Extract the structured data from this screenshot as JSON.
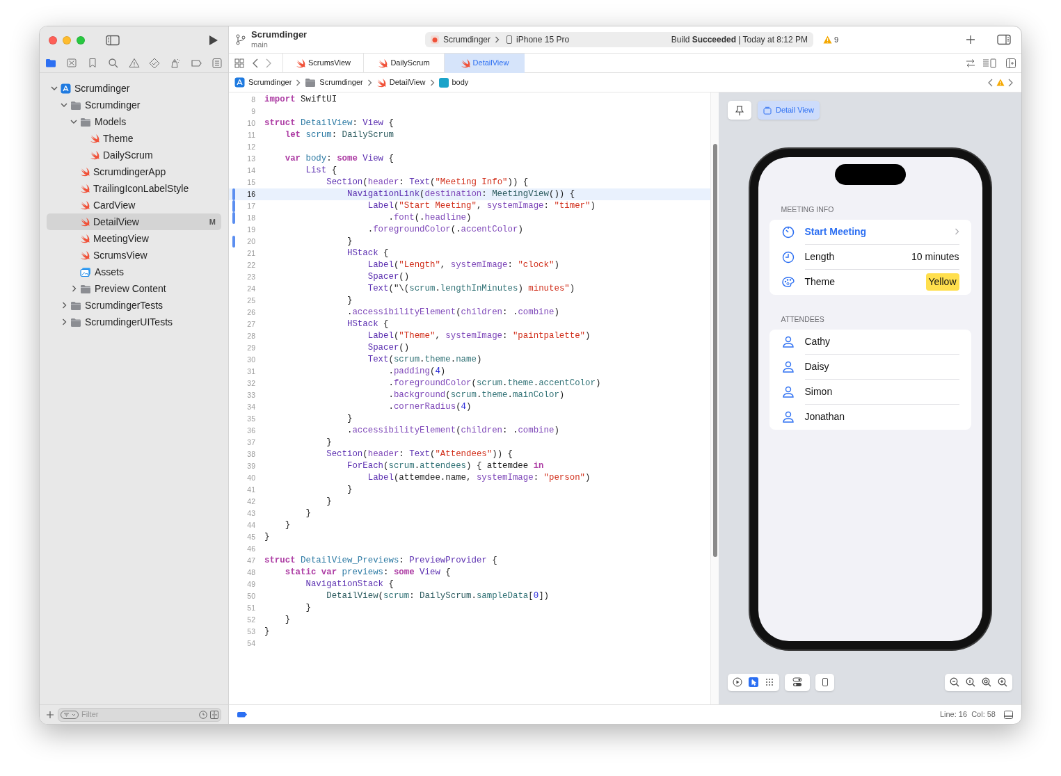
{
  "toolbar": {
    "project": "Scrumdinger",
    "branch": "main",
    "scheme": "Scrumdinger",
    "device": "iPhone 15 Pro",
    "build_status": "Build **Succeeded** | Today at 8:12 PM",
    "warning_count": "9"
  },
  "navigator_tabs": [
    {
      "kind": "project",
      "selected": true
    },
    {
      "kind": "source_control",
      "selected": false
    },
    {
      "kind": "bookmarks",
      "selected": false
    },
    {
      "kind": "find",
      "selected": false
    },
    {
      "kind": "issues",
      "selected": false
    },
    {
      "kind": "tests",
      "selected": false
    },
    {
      "kind": "debug",
      "selected": false
    },
    {
      "kind": "breakpoints",
      "selected": false
    },
    {
      "kind": "reports",
      "selected": false
    }
  ],
  "navigator": {
    "tree": [
      {
        "label": "Scrumdinger",
        "kind": "project",
        "expanded": true,
        "selected": false,
        "children": [
          {
            "label": "Scrumdinger",
            "kind": "folder",
            "expanded": true,
            "selected": false,
            "children": [
              {
                "label": "Models",
                "kind": "folder",
                "expanded": true,
                "selected": false,
                "children": [
                  {
                    "label": "Theme",
                    "kind": "swift",
                    "selected": false
                  },
                  {
                    "label": "DailyScrum",
                    "kind": "swift",
                    "selected": false
                  }
                ]
              },
              {
                "label": "ScrumdingerApp",
                "kind": "swift",
                "selected": false
              },
              {
                "label": "TrailingIconLabelStyle",
                "kind": "swift",
                "selected": false
              },
              {
                "label": "CardView",
                "kind": "swift",
                "selected": false
              },
              {
                "label": "DetailView",
                "kind": "swift",
                "selected": true,
                "badge": "M"
              },
              {
                "label": "MeetingView",
                "kind": "swift",
                "selected": false
              },
              {
                "label": "ScrumsView",
                "kind": "swift",
                "selected": false
              },
              {
                "label": "Assets",
                "kind": "assets",
                "selected": false
              },
              {
                "label": "Preview Content",
                "kind": "folder",
                "expanded": false,
                "selected": false
              }
            ]
          },
          {
            "label": "ScrumdingerTests",
            "kind": "folder",
            "expanded": false,
            "selected": false
          },
          {
            "label": "ScrumdingerUITests",
            "kind": "folder",
            "expanded": false,
            "selected": false
          }
        ]
      }
    ],
    "filter_placeholder": "Filter"
  },
  "editor": {
    "tabs": [
      {
        "label": "ScrumsView",
        "selected": false
      },
      {
        "label": "DailyScrum",
        "selected": false
      },
      {
        "label": "DetailView",
        "selected": true
      }
    ],
    "breadcrumbs": [
      {
        "label": "Scrumdinger",
        "kind": "project"
      },
      {
        "label": "Scrumdinger",
        "kind": "folder"
      },
      {
        "label": "DetailView",
        "kind": "swift"
      },
      {
        "label": "body",
        "kind": "property"
      }
    ],
    "lines": [
      {
        "number": "8",
        "current": false,
        "changed": false,
        "tokens": [
          {
            "kind": "kw",
            "text": "import"
          },
          {
            "kind": "plain",
            "text": " SwiftUI"
          }
        ]
      },
      {
        "number": "9",
        "current": false,
        "changed": false
      },
      {
        "number": "10",
        "current": false,
        "changed": false,
        "tokens": [
          {
            "kind": "kw",
            "text": "struct "
          },
          {
            "kind": "decl",
            "text": "DetailView"
          },
          {
            "kind": "plain",
            "text": ": "
          },
          {
            "kind": "sys",
            "text": "View"
          },
          {
            "kind": "plain",
            "text": " {"
          }
        ]
      },
      {
        "number": "11",
        "current": false,
        "changed": false,
        "tokens": [
          {
            "kind": "kw",
            "text": "    let "
          },
          {
            "kind": "decl",
            "text": "scrum"
          },
          {
            "kind": "plain",
            "text": ": "
          },
          {
            "kind": "proj",
            "text": "DailyScrum"
          }
        ]
      },
      {
        "number": "12",
        "current": false,
        "changed": false
      },
      {
        "number": "13",
        "current": false,
        "changed": false,
        "tokens": [
          {
            "kind": "kw",
            "text": "    var "
          },
          {
            "kind": "decl",
            "text": "body"
          },
          {
            "kind": "plain",
            "text": ": "
          },
          {
            "kind": "kw",
            "text": "some "
          },
          {
            "kind": "sys",
            "text": "View"
          },
          {
            "kind": "plain",
            "text": " {"
          }
        ]
      },
      {
        "number": "14",
        "current": false,
        "changed": false,
        "tokens": [
          {
            "kind": "sys",
            "text": "        List"
          },
          {
            "kind": "plain",
            "text": " {"
          }
        ]
      },
      {
        "number": "15",
        "current": false,
        "changed": false,
        "tokens": [
          {
            "kind": "sys",
            "text": "            Section"
          },
          {
            "kind": "plain",
            "text": "("
          },
          {
            "kind": "member",
            "text": "header"
          },
          {
            "kind": "plain",
            "text": ": "
          },
          {
            "kind": "sys",
            "text": "Text"
          },
          {
            "kind": "plain",
            "text": "("
          },
          {
            "kind": "str",
            "text": "\"Meeting Info\""
          },
          {
            "kind": "plain",
            "text": ")) {"
          }
        ]
      },
      {
        "number": "16",
        "current": true,
        "changed": true,
        "tokens": [
          {
            "kind": "sys",
            "text": "                NavigationLink"
          },
          {
            "kind": "plain",
            "text": "("
          },
          {
            "kind": "member",
            "text": "destination"
          },
          {
            "kind": "plain",
            "text": ": "
          },
          {
            "kind": "proj",
            "text": "MeetingView"
          },
          {
            "kind": "plain",
            "text": "()) {"
          }
        ]
      },
      {
        "number": "17",
        "current": false,
        "changed": true,
        "tokens": [
          {
            "kind": "sys",
            "text": "                    Label"
          },
          {
            "kind": "plain",
            "text": "("
          },
          {
            "kind": "str",
            "text": "\"Start Meeting\""
          },
          {
            "kind": "plain",
            "text": ", "
          },
          {
            "kind": "member",
            "text": "systemImage"
          },
          {
            "kind": "plain",
            "text": ": "
          },
          {
            "kind": "str",
            "text": "\"timer\""
          },
          {
            "kind": "plain",
            "text": ")"
          }
        ]
      },
      {
        "number": "18",
        "current": false,
        "changed": true,
        "tokens": [
          {
            "kind": "plain",
            "text": "                        ."
          },
          {
            "kind": "member",
            "text": "font"
          },
          {
            "kind": "plain",
            "text": "(."
          },
          {
            "kind": "member",
            "text": "headline"
          },
          {
            "kind": "plain",
            "text": ")"
          }
        ]
      },
      {
        "number": "19",
        "current": false,
        "changed": false,
        "tokens": [
          {
            "kind": "plain",
            "text": "                    ."
          },
          {
            "kind": "member",
            "text": "foregroundColor"
          },
          {
            "kind": "plain",
            "text": "(."
          },
          {
            "kind": "member",
            "text": "accentColor"
          },
          {
            "kind": "plain",
            "text": ")"
          }
        ]
      },
      {
        "number": "20",
        "current": false,
        "changed": true,
        "tokens": [
          {
            "kind": "plain",
            "text": "                }"
          }
        ]
      },
      {
        "number": "21",
        "current": false,
        "changed": false,
        "tokens": [
          {
            "kind": "sys",
            "text": "                HStack"
          },
          {
            "kind": "plain",
            "text": " {"
          }
        ]
      },
      {
        "number": "22",
        "current": false,
        "changed": false,
        "tokens": [
          {
            "kind": "sys",
            "text": "                    Label"
          },
          {
            "kind": "plain",
            "text": "("
          },
          {
            "kind": "str",
            "text": "\"Length\""
          },
          {
            "kind": "plain",
            "text": ", "
          },
          {
            "kind": "member",
            "text": "systemImage"
          },
          {
            "kind": "plain",
            "text": ": "
          },
          {
            "kind": "str",
            "text": "\"clock\""
          },
          {
            "kind": "plain",
            "text": ")"
          }
        ]
      },
      {
        "number": "23",
        "current": false,
        "changed": false,
        "tokens": [
          {
            "kind": "sys",
            "text": "                    Spacer"
          },
          {
            "kind": "plain",
            "text": "()"
          }
        ]
      },
      {
        "number": "24",
        "current": false,
        "changed": false,
        "tokens": [
          {
            "kind": "sys",
            "text": "                    Text"
          },
          {
            "kind": "plain",
            "text": "(\"\\("
          },
          {
            "kind": "prop",
            "text": "scrum"
          },
          {
            "kind": "plain",
            "text": "."
          },
          {
            "kind": "prop",
            "text": "lengthInMinutes"
          },
          {
            "kind": "plain",
            "text": ")"
          },
          {
            "kind": "str",
            "text": " minutes\""
          },
          {
            "kind": "plain",
            "text": ")"
          }
        ]
      },
      {
        "number": "25",
        "current": false,
        "changed": false,
        "tokens": [
          {
            "kind": "plain",
            "text": "                }"
          }
        ]
      },
      {
        "number": "26",
        "current": false,
        "changed": false,
        "tokens": [
          {
            "kind": "plain",
            "text": "                ."
          },
          {
            "kind": "member",
            "text": "accessibilityElement"
          },
          {
            "kind": "plain",
            "text": "("
          },
          {
            "kind": "member",
            "text": "children"
          },
          {
            "kind": "plain",
            "text": ": ."
          },
          {
            "kind": "member",
            "text": "combine"
          },
          {
            "kind": "plain",
            "text": ")"
          }
        ]
      },
      {
        "number": "27",
        "current": false,
        "changed": false,
        "tokens": [
          {
            "kind": "sys",
            "text": "                HStack"
          },
          {
            "kind": "plain",
            "text": " {"
          }
        ]
      },
      {
        "number": "28",
        "current": false,
        "changed": false,
        "tokens": [
          {
            "kind": "sys",
            "text": "                    Label"
          },
          {
            "kind": "plain",
            "text": "("
          },
          {
            "kind": "str",
            "text": "\"Theme\""
          },
          {
            "kind": "plain",
            "text": ", "
          },
          {
            "kind": "member",
            "text": "systemImage"
          },
          {
            "kind": "plain",
            "text": ": "
          },
          {
            "kind": "str",
            "text": "\"paintpalette\""
          },
          {
            "kind": "plain",
            "text": ")"
          }
        ]
      },
      {
        "number": "29",
        "current": false,
        "changed": false,
        "tokens": [
          {
            "kind": "sys",
            "text": "                    Spacer"
          },
          {
            "kind": "plain",
            "text": "()"
          }
        ]
      },
      {
        "number": "30",
        "current": false,
        "changed": false,
        "tokens": [
          {
            "kind": "sys",
            "text": "                    Text"
          },
          {
            "kind": "plain",
            "text": "("
          },
          {
            "kind": "prop",
            "text": "scrum"
          },
          {
            "kind": "plain",
            "text": "."
          },
          {
            "kind": "prop",
            "text": "theme"
          },
          {
            "kind": "plain",
            "text": "."
          },
          {
            "kind": "prop",
            "text": "name"
          },
          {
            "kind": "plain",
            "text": ")"
          }
        ]
      },
      {
        "number": "31",
        "current": false,
        "changed": false,
        "tokens": [
          {
            "kind": "plain",
            "text": "                        ."
          },
          {
            "kind": "member",
            "text": "padding"
          },
          {
            "kind": "plain",
            "text": "("
          },
          {
            "kind": "num",
            "text": "4"
          },
          {
            "kind": "plain",
            "text": ")"
          }
        ]
      },
      {
        "number": "32",
        "current": false,
        "changed": false,
        "tokens": [
          {
            "kind": "plain",
            "text": "                        ."
          },
          {
            "kind": "member",
            "text": "foregroundColor"
          },
          {
            "kind": "plain",
            "text": "("
          },
          {
            "kind": "prop",
            "text": "scrum"
          },
          {
            "kind": "plain",
            "text": "."
          },
          {
            "kind": "prop",
            "text": "theme"
          },
          {
            "kind": "plain",
            "text": "."
          },
          {
            "kind": "prop",
            "text": "accentColor"
          },
          {
            "kind": "plain",
            "text": ")"
          }
        ]
      },
      {
        "number": "33",
        "current": false,
        "changed": false,
        "tokens": [
          {
            "kind": "plain",
            "text": "                        ."
          },
          {
            "kind": "member",
            "text": "background"
          },
          {
            "kind": "plain",
            "text": "("
          },
          {
            "kind": "prop",
            "text": "scrum"
          },
          {
            "kind": "plain",
            "text": "."
          },
          {
            "kind": "prop",
            "text": "theme"
          },
          {
            "kind": "plain",
            "text": "."
          },
          {
            "kind": "prop",
            "text": "mainColor"
          },
          {
            "kind": "plain",
            "text": ")"
          }
        ]
      },
      {
        "number": "34",
        "current": false,
        "changed": false,
        "tokens": [
          {
            "kind": "plain",
            "text": "                        ."
          },
          {
            "kind": "member",
            "text": "cornerRadius"
          },
          {
            "kind": "plain",
            "text": "("
          },
          {
            "kind": "num",
            "text": "4"
          },
          {
            "kind": "plain",
            "text": ")"
          }
        ]
      },
      {
        "number": "35",
        "current": false,
        "changed": false,
        "tokens": [
          {
            "kind": "plain",
            "text": "                }"
          }
        ]
      },
      {
        "number": "36",
        "current": false,
        "changed": false,
        "tokens": [
          {
            "kind": "plain",
            "text": "                ."
          },
          {
            "kind": "member",
            "text": "accessibilityElement"
          },
          {
            "kind": "plain",
            "text": "("
          },
          {
            "kind": "member",
            "text": "children"
          },
          {
            "kind": "plain",
            "text": ": ."
          },
          {
            "kind": "member",
            "text": "combine"
          },
          {
            "kind": "plain",
            "text": ")"
          }
        ]
      },
      {
        "number": "37",
        "current": false,
        "changed": false,
        "tokens": [
          {
            "kind": "plain",
            "text": "            }"
          }
        ]
      },
      {
        "number": "38",
        "current": false,
        "changed": false,
        "tokens": [
          {
            "kind": "sys",
            "text": "            Section"
          },
          {
            "kind": "plain",
            "text": "("
          },
          {
            "kind": "member",
            "text": "header"
          },
          {
            "kind": "plain",
            "text": ": "
          },
          {
            "kind": "sys",
            "text": "Text"
          },
          {
            "kind": "plain",
            "text": "("
          },
          {
            "kind": "str",
            "text": "\"Attendees\""
          },
          {
            "kind": "plain",
            "text": ")) {"
          }
        ]
      },
      {
        "number": "39",
        "current": false,
        "changed": false,
        "tokens": [
          {
            "kind": "sys",
            "text": "                ForEach"
          },
          {
            "kind": "plain",
            "text": "("
          },
          {
            "kind": "prop",
            "text": "scrum"
          },
          {
            "kind": "plain",
            "text": "."
          },
          {
            "kind": "prop",
            "text": "attendees"
          },
          {
            "kind": "plain",
            "text": ") { attemdee "
          },
          {
            "kind": "kw",
            "text": "in"
          }
        ]
      },
      {
        "number": "40",
        "current": false,
        "changed": false,
        "tokens": [
          {
            "kind": "sys",
            "text": "                    Label"
          },
          {
            "kind": "plain",
            "text": "(attemdee.name, "
          },
          {
            "kind": "member",
            "text": "systemImage"
          },
          {
            "kind": "plain",
            "text": ": "
          },
          {
            "kind": "str",
            "text": "\"person\""
          },
          {
            "kind": "plain",
            "text": ")"
          }
        ]
      },
      {
        "number": "41",
        "current": false,
        "changed": false,
        "tokens": [
          {
            "kind": "plain",
            "text": "                }"
          }
        ]
      },
      {
        "number": "42",
        "current": false,
        "changed": false,
        "tokens": [
          {
            "kind": "plain",
            "text": "            }"
          }
        ]
      },
      {
        "number": "43",
        "current": false,
        "changed": false,
        "tokens": [
          {
            "kind": "plain",
            "text": "        }"
          }
        ]
      },
      {
        "number": "44",
        "current": false,
        "changed": false,
        "tokens": [
          {
            "kind": "plain",
            "text": "    }"
          }
        ]
      },
      {
        "number": "45",
        "current": false,
        "changed": false,
        "tokens": [
          {
            "kind": "plain",
            "text": "}"
          }
        ]
      },
      {
        "number": "46",
        "current": false,
        "changed": false
      },
      {
        "number": "47",
        "current": false,
        "changed": false,
        "tokens": [
          {
            "kind": "kw",
            "text": "struct "
          },
          {
            "kind": "decl",
            "text": "DetailView_Previews"
          },
          {
            "kind": "plain",
            "text": ": "
          },
          {
            "kind": "sys",
            "text": "PreviewProvider"
          },
          {
            "kind": "plain",
            "text": " {"
          }
        ]
      },
      {
        "number": "48",
        "current": false,
        "changed": false,
        "tokens": [
          {
            "kind": "kw",
            "text": "    static var "
          },
          {
            "kind": "decl",
            "text": "previews"
          },
          {
            "kind": "plain",
            "text": ": "
          },
          {
            "kind": "kw",
            "text": "some "
          },
          {
            "kind": "sys",
            "text": "View"
          },
          {
            "kind": "plain",
            "text": " {"
          }
        ]
      },
      {
        "number": "49",
        "current": false,
        "changed": false,
        "tokens": [
          {
            "kind": "sys",
            "text": "        NavigationStack"
          },
          {
            "kind": "plain",
            "text": " {"
          }
        ]
      },
      {
        "number": "50",
        "current": false,
        "changed": false,
        "tokens": [
          {
            "kind": "proj",
            "text": "            DetailView"
          },
          {
            "kind": "plain",
            "text": "("
          },
          {
            "kind": "prop",
            "text": "scrum"
          },
          {
            "kind": "plain",
            "text": ": "
          },
          {
            "kind": "proj",
            "text": "DailyScrum"
          },
          {
            "kind": "plain",
            "text": "."
          },
          {
            "kind": "prop",
            "text": "sampleData"
          },
          {
            "kind": "plain",
            "text": "["
          },
          {
            "kind": "num",
            "text": "0"
          },
          {
            "kind": "plain",
            "text": "])"
          }
        ]
      },
      {
        "number": "51",
        "current": false,
        "changed": false,
        "tokens": [
          {
            "kind": "plain",
            "text": "        }"
          }
        ]
      },
      {
        "number": "52",
        "current": false,
        "changed": false,
        "tokens": [
          {
            "kind": "plain",
            "text": "    }"
          }
        ]
      },
      {
        "number": "53",
        "current": false,
        "changed": false,
        "tokens": [
          {
            "kind": "plain",
            "text": "}"
          }
        ]
      },
      {
        "number": "54",
        "current": false,
        "changed": false
      }
    ]
  },
  "canvas": {
    "preview_button": "Detail View",
    "sections": [
      {
        "header": "MEETING INFO",
        "rows": [
          {
            "kind": "link",
            "label": "Start Meeting"
          },
          {
            "kind": "length",
            "label": "Length",
            "value": "10 minutes"
          },
          {
            "kind": "theme",
            "label": "Theme",
            "value": "Yellow",
            "color": "#ffdf4d"
          }
        ]
      },
      {
        "header": "ATTENDEES",
        "rows": [
          {
            "kind": "person",
            "label": "Cathy"
          },
          {
            "kind": "person",
            "label": "Daisy"
          },
          {
            "kind": "person",
            "label": "Simon"
          },
          {
            "kind": "person",
            "label": "Jonathan"
          }
        ]
      }
    ],
    "modes": [
      {
        "kind": "live",
        "selected": false
      },
      {
        "kind": "selectable",
        "selected": true
      },
      {
        "kind": "variants",
        "selected": false
      }
    ]
  },
  "status_bar": {
    "breakpoints_active": true,
    "position": "Line: 16  Col: 58"
  }
}
